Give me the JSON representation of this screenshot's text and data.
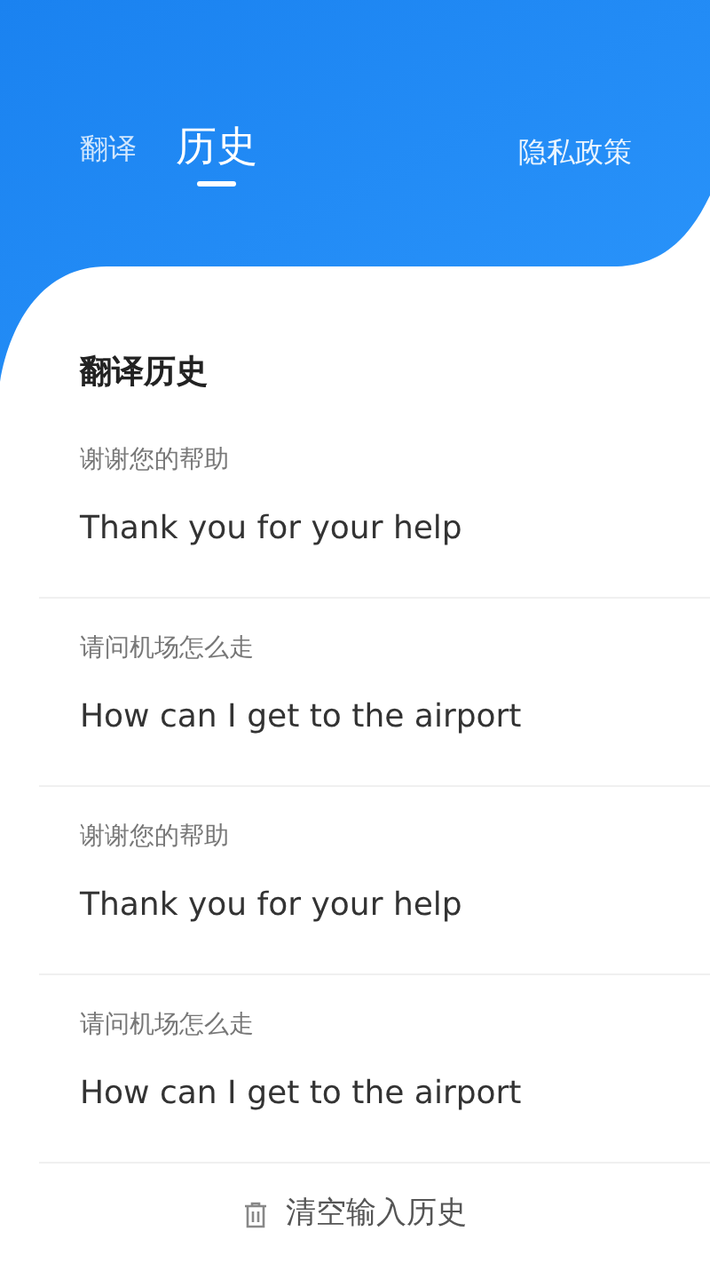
{
  "tabs": [
    {
      "label": "翻译",
      "selected": false
    },
    {
      "label": "历史",
      "selected": true
    }
  ],
  "privacy_link": "隐私政策",
  "section_title": "翻译历史",
  "history": [
    {
      "source": "谢谢您的帮助",
      "translation": "Thank you for your help"
    },
    {
      "source": "请问机场怎么走",
      "translation": "How can I get to the airport"
    },
    {
      "source": "谢谢您的帮助",
      "translation": "Thank you for your help"
    },
    {
      "source": "请问机场怎么走",
      "translation": "How can I get to the airport"
    }
  ],
  "clear_button": "清空输入历史"
}
